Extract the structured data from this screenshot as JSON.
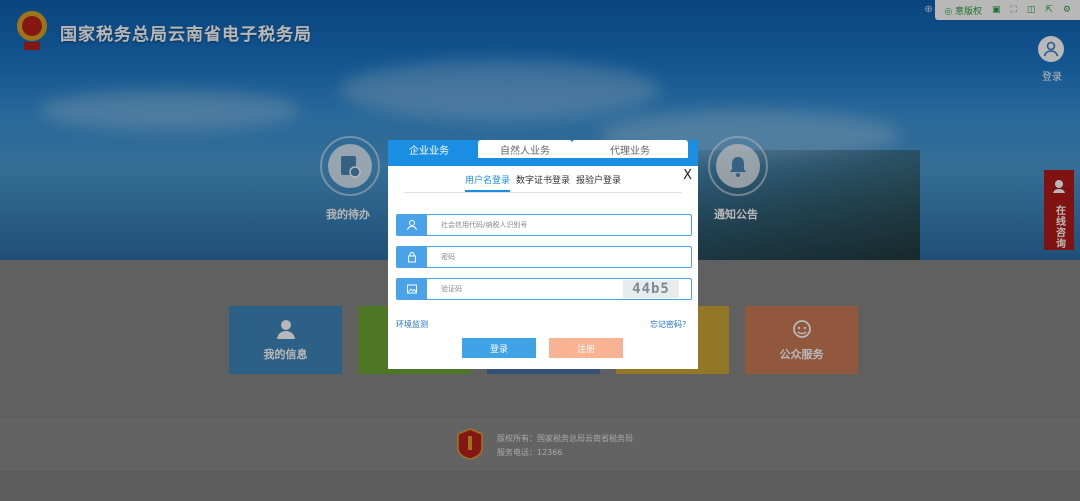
{
  "site": {
    "title": "国家税务总局云南省电子税务局"
  },
  "toolbar": {
    "left_text": "⊕ T",
    "items": [
      {
        "icon": "elder-mode-icon",
        "label": "◎ 意版权"
      },
      {
        "icon": "screen-icon",
        "label": "▣"
      },
      {
        "icon": "fullscreen-icon",
        "label": "⛶"
      },
      {
        "icon": "window-icon",
        "label": "◫"
      },
      {
        "icon": "share-icon",
        "label": "⇱"
      },
      {
        "icon": "settings-icon",
        "label": "⚙"
      }
    ]
  },
  "user": {
    "login_label": "登录"
  },
  "consult": {
    "label": "在线咨询"
  },
  "circles": [
    {
      "label": "我的待办",
      "icon": "todo-icon"
    },
    {
      "label": "通知公告",
      "icon": "bell-icon"
    }
  ],
  "tiles": [
    {
      "label": "我的信息",
      "icon": "person-icon",
      "color": "#3f86ba"
    },
    {
      "label": "",
      "icon": "green-tile-icon",
      "color": "#6ba632"
    },
    {
      "label": "",
      "icon": "blue-tile-icon",
      "color": "#496fa8"
    },
    {
      "label": "",
      "icon": "yellow-tile-icon",
      "color": "#c9a535"
    },
    {
      "label": "公众服务",
      "icon": "service-icon",
      "color": "#c97a55"
    }
  ],
  "footer": {
    "copyright": "版权所有：国家税务总局云南省税务局",
    "phone": "服务电话：12366"
  },
  "modal": {
    "tabs": [
      "企业业务",
      "自然人业务",
      "代理业务"
    ],
    "close": "X",
    "subtabs": [
      "用户名登录",
      "数字证书登录",
      "报验户登录"
    ],
    "fields": {
      "account_placeholder": "社会信用代码/纳税人识别号",
      "password_placeholder": "密码",
      "captcha_placeholder": "验证码",
      "captcha_text": "44b5"
    },
    "env_link": "环境监测",
    "forgot_link": "忘记密码？",
    "login_button": "登录",
    "register_button": "注册"
  }
}
